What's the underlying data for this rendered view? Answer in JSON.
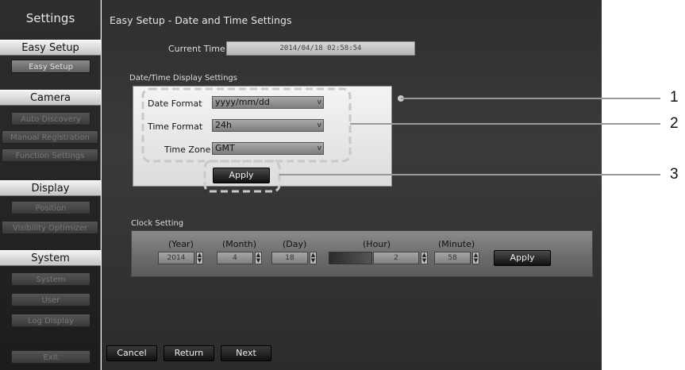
{
  "sidebar": {
    "title": "Settings",
    "sections": [
      {
        "heading": "Easy Setup",
        "items": [
          "Easy Setup"
        ]
      },
      {
        "heading": "Camera",
        "items": [
          "Auto Discovery",
          "Manual Registration",
          "Function Settings"
        ]
      },
      {
        "heading": "Display",
        "items": [
          "Position",
          "Visibility Optimizer"
        ]
      },
      {
        "heading": "System",
        "items": [
          "System",
          "User",
          "Log Display"
        ]
      }
    ],
    "exit_label": "Exit"
  },
  "main": {
    "title": "Easy Setup - Date and Time Settings",
    "current_time_label": "Current Time",
    "current_time_value": "2014/04/18 02:58:54",
    "display_settings": {
      "heading": "Date/Time Display Settings",
      "date_format_label": "Date Format",
      "date_format_value": "yyyy/mm/dd",
      "time_format_label": "Time Format",
      "time_format_value": "24h",
      "time_zone_label": "Time Zone",
      "time_zone_value": "GMT",
      "apply_label": "Apply"
    },
    "clock": {
      "heading": "Clock Setting",
      "year_label": "(Year)",
      "year_value": "2014",
      "month_label": "(Month)",
      "month_value": "4",
      "day_label": "(Day)",
      "day_value": "18",
      "hour_label": "(Hour)",
      "hour_value": "2",
      "minute_label": "(Minute)",
      "minute_value": "58",
      "apply_label": "Apply"
    },
    "buttons": {
      "cancel": "Cancel",
      "return": "Return",
      "next": "Next"
    }
  },
  "callouts": {
    "one": "1",
    "two": "2",
    "three": "3"
  },
  "icons": {
    "dropdown": "chevron-down-icon",
    "spinner": "up-down-arrows-icon"
  }
}
